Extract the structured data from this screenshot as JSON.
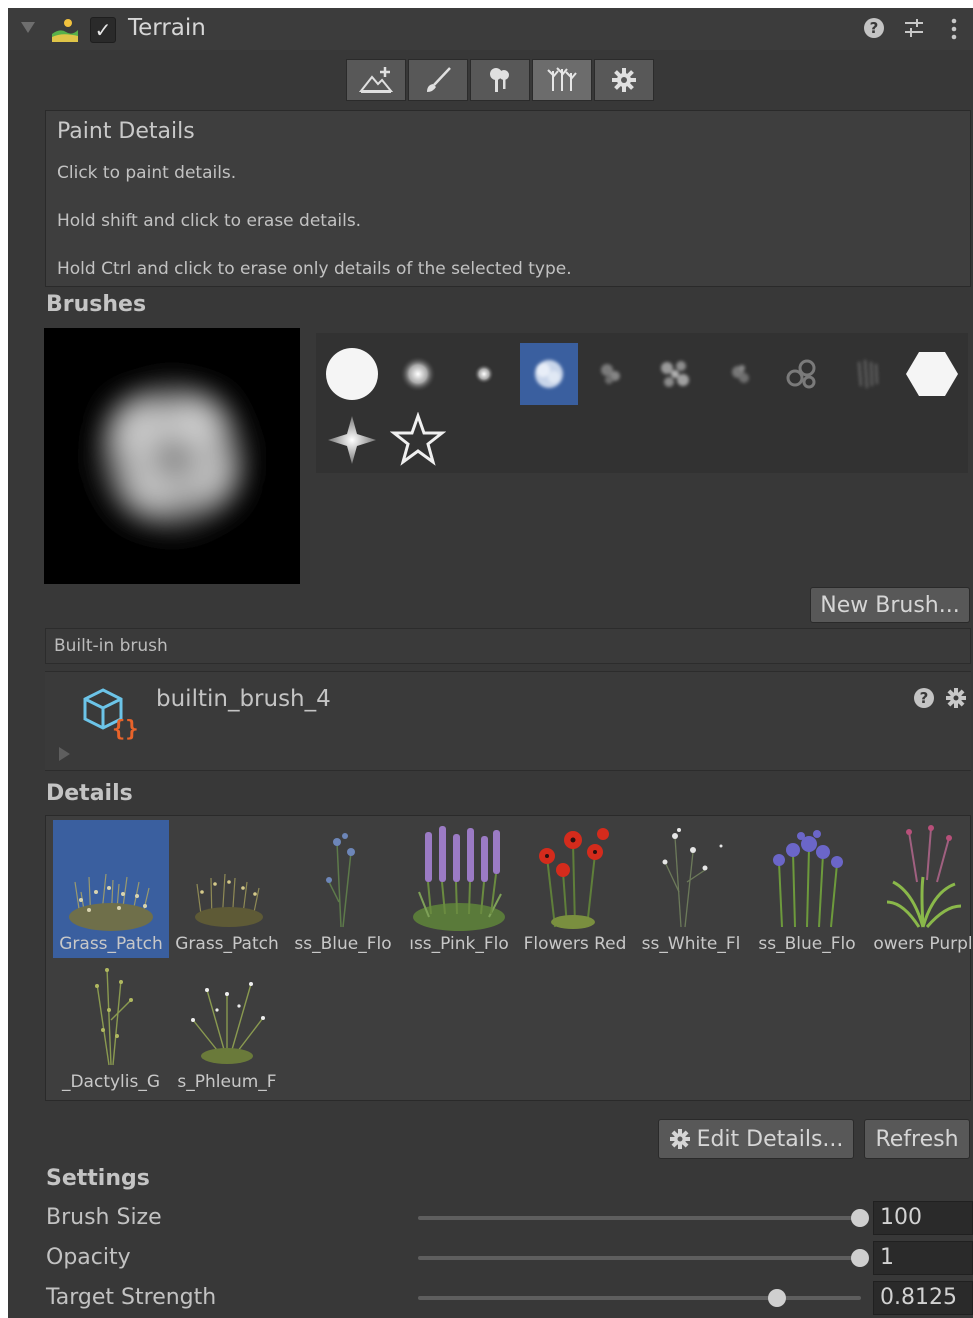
{
  "header": {
    "title": "Terrain",
    "enabled": true,
    "help_glyph": "?"
  },
  "toolbar": {
    "tools": [
      {
        "icon": "create-neighbor-terrains-icon",
        "active": false
      },
      {
        "icon": "paint-terrain-brush-icon",
        "active": false
      },
      {
        "icon": "paint-trees-icon",
        "active": false
      },
      {
        "icon": "paint-details-icon",
        "active": true
      },
      {
        "icon": "terrain-settings-gear-icon",
        "active": false
      }
    ]
  },
  "info": {
    "title": "Paint Details",
    "lines": [
      "Click to paint details.",
      "Hold shift and click to erase details.",
      "Hold Ctrl and click to erase only details of the selected type."
    ]
  },
  "brushes": {
    "label": "Brushes",
    "selected_index": 3,
    "new_brush_label": "New Brush...",
    "builtin_label": "Built-in brush",
    "asset_name": "builtin_brush_4",
    "asset_help_glyph": "?"
  },
  "details": {
    "label": "Details",
    "items": [
      {
        "label": "Grass_Patch",
        "selected": true
      },
      {
        "label": "Grass_Patch",
        "selected": false
      },
      {
        "label": "ss_Blue_Flo",
        "selected": false
      },
      {
        "label": "ıss_Pink_Flo",
        "selected": false
      },
      {
        "label": "Flowers Red",
        "selected": false
      },
      {
        "label": "ss_White_Fl",
        "selected": false
      },
      {
        "label": "ss_Blue_Flo",
        "selected": false
      },
      {
        "label": "owers Purpl",
        "selected": false
      },
      {
        "label": "_Dactylis_G",
        "selected": false
      },
      {
        "label": "s_Phleum_F",
        "selected": false
      }
    ],
    "edit_label": "Edit Details...",
    "refresh_label": "Refresh"
  },
  "settings": {
    "label": "Settings",
    "rows": [
      {
        "label": "Brush Size",
        "value": "100",
        "fraction": 1.0
      },
      {
        "label": "Opacity",
        "value": "1",
        "fraction": 1.0
      },
      {
        "label": "Target Strength",
        "value": "0.8125",
        "fraction": 0.8125
      }
    ]
  },
  "colors": {
    "panel_bg": "#383838",
    "selection": "#3a5f9f",
    "button_bg": "#585858",
    "field_bg": "#2a2a2a"
  }
}
